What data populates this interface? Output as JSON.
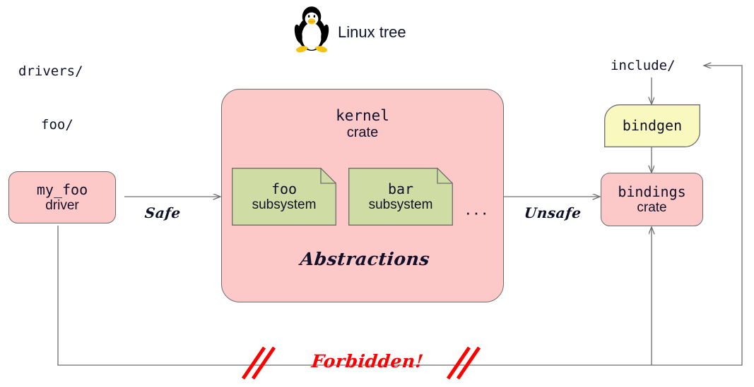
{
  "diagram": {
    "title": "Linux tree",
    "logo_icon": "tux-penguin-icon",
    "paths": {
      "drivers": "drivers/",
      "foo": "foo/",
      "include": "include/"
    },
    "nodes": {
      "my_foo_driver": {
        "line1": "my_foo",
        "line2": "driver",
        "color": "#fdc8c8"
      },
      "kernel_crate": {
        "line1": "kernel",
        "line2": "crate",
        "color": "#fdc8c8"
      },
      "foo_subsystem": {
        "line1": "foo",
        "line2": "subsystem",
        "color": "#cfdca4"
      },
      "bar_subsystem": {
        "line1": "bar",
        "line2": "subsystem",
        "color": "#cfdca4"
      },
      "more_subsystems": {
        "label": "···"
      },
      "abstractions": {
        "label": "Abstractions"
      },
      "bindgen": {
        "label": "bindgen",
        "color": "#f9f8bf"
      },
      "bindings_crate": {
        "line1": "bindings",
        "line2": "crate",
        "color": "#fdc8c8"
      }
    },
    "edges": {
      "safe": "Safe",
      "unsafe": "Unsafe",
      "forbidden": "Forbidden!"
    },
    "colors": {
      "pink": "#fdc8c8",
      "green": "#cfdca4",
      "yellow": "#f9f8bf",
      "stroke": "#6d6d6d",
      "forbidden_red": "#ff0000",
      "text": "#10102a"
    }
  }
}
